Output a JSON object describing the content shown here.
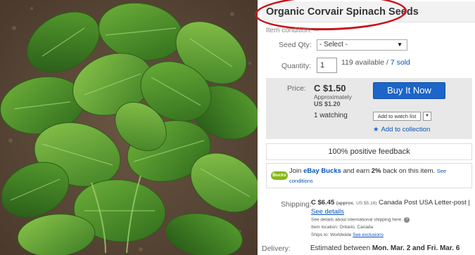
{
  "product": {
    "title": "Organic Corvair Spinach Seeds",
    "image_alt": "spinach plant photo"
  },
  "condition": {
    "label": "Item condition:",
    "value": "--"
  },
  "seed_qty": {
    "label": "Seed Qty:",
    "selected": "- Select -"
  },
  "quantity": {
    "label": "Quantity:",
    "value": "1",
    "available": "119 available",
    "sep": " / ",
    "sold": "7 sold"
  },
  "price": {
    "label": "Price:",
    "amount": "C $1.50",
    "approx_label": "Approximately",
    "approx_value": "US $1.20",
    "buy_label": "Buy It Now",
    "watching": "1 watching",
    "watch_button": "Add to watch list",
    "collection_link": "Add to collection"
  },
  "feedback": "100% positive feedback",
  "bucks": {
    "icon_text": "Bucks",
    "text_1": "Join ",
    "brand": "eBay Bucks",
    "text_2": " and earn ",
    "percent": "2%",
    "text_3": " back on this item. ",
    "link": "See conditions"
  },
  "shipping": {
    "label": "Shipping:",
    "amount": "C $6.45",
    "approx": "(approx.",
    "approx_value": "US $5.16)",
    "carrier": "Canada Post USA Letter-post |",
    "details_link": "See details",
    "intl_note": "See details about international shipping here.",
    "location": "Item location: Ontario, Canada",
    "ships_to": "Ships to: Worldwide",
    "exclusions_link": "See exclusions"
  },
  "delivery": {
    "label": "Delivery:",
    "prefix": "Estimated between ",
    "dates": "Mon. Mar. 2 and Fri. Mar. 6"
  },
  "colors": {
    "accent": "#1d65c9",
    "highlight": "#c8141b",
    "link": "#0654ba",
    "bucks": "#86b817"
  },
  "icons": [
    "star-icon",
    "dropdown-arrow-icon",
    "help-icon",
    "ebay-bucks-icon"
  ]
}
